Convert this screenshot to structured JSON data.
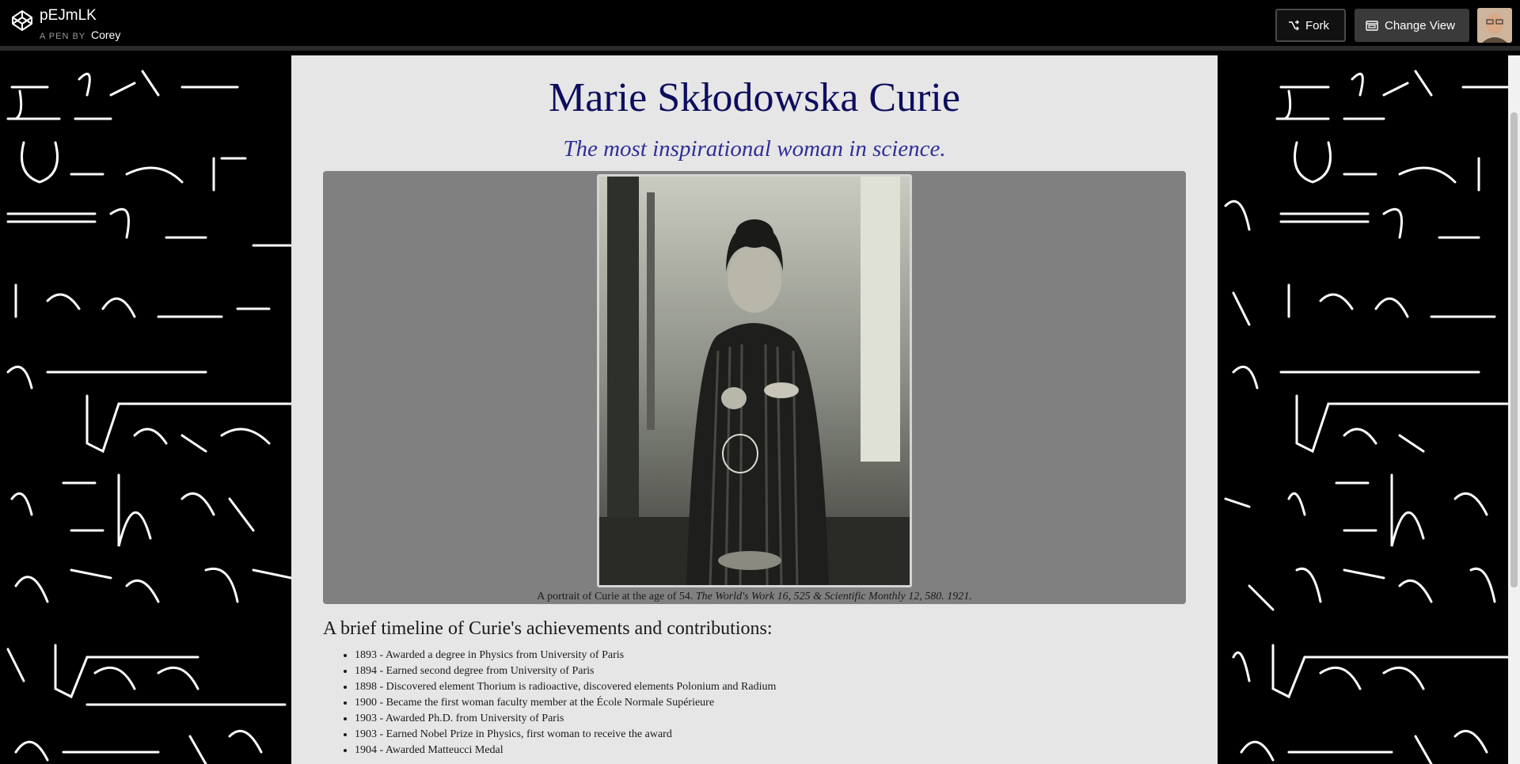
{
  "topbar": {
    "pen_title": "pEJmLK",
    "pen_by_prefix": "A PEN BY",
    "pen_author": "Corey",
    "fork_label": "Fork",
    "change_view_label": "Change View"
  },
  "page": {
    "title": "Marie Skłodowska Curie",
    "subtitle": "The most inspirational woman in science.",
    "caption_text": "A portrait of Curie at the age of 54.",
    "caption_source": "The World's Work 16, 525 & Scientific Monthly 12, 580. 1921.",
    "timeline_heading": "A brief timeline of Curie's achievements and contributions:",
    "timeline": [
      "1893 - Awarded a degree in Physics from University of Paris",
      "1894 - Earned second degree from University of Paris",
      "1898 - Discovered element Thorium is radioactive, discovered elements Polonium and Radium",
      "1900 - Became the first woman faculty member at the École Normale Supérieure",
      "1903 - Awarded Ph.D. from University of Paris",
      "1903 - Earned Nobel Prize in Physics, first woman to receive the award",
      "1904 - Awarded Matteucci Medal"
    ]
  },
  "colors": {
    "title": "#0d0d5e",
    "subtitle": "#2f2f9a",
    "content_bg": "#e6e6e6",
    "image_box_bg": "#808080"
  }
}
